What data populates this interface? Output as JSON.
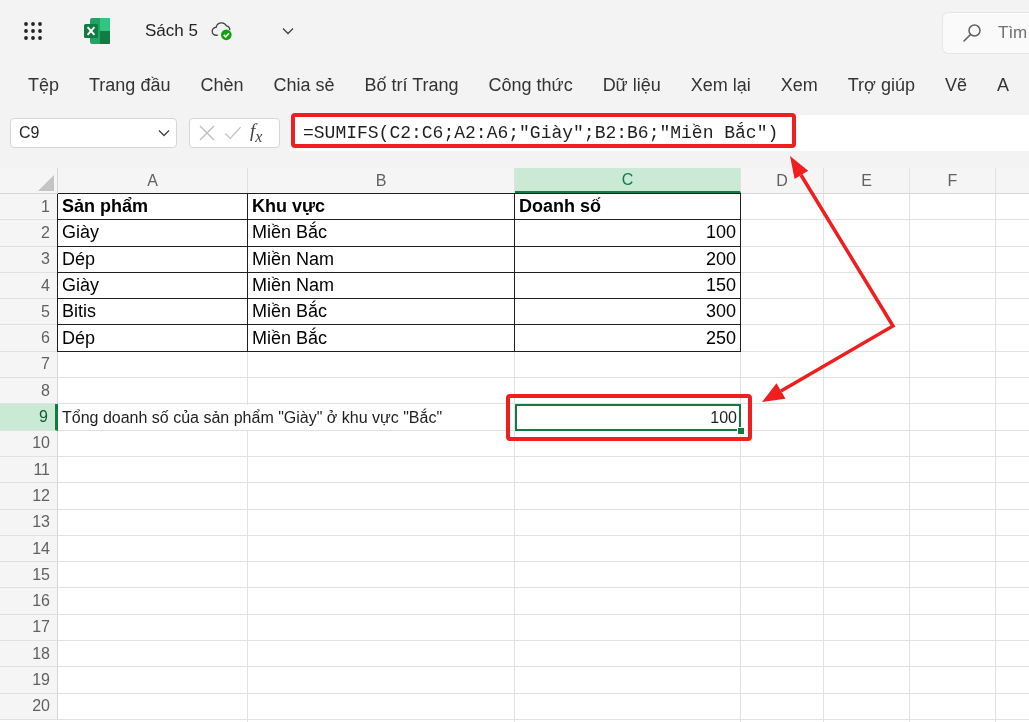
{
  "app_bar": {
    "document_title": "Sách 5",
    "search": {
      "placeholder": "Tìm"
    }
  },
  "menu": [
    "Tệp",
    "Trang đầu",
    "Chèn",
    "Chia sẻ",
    "Bố trí Trang",
    "Công thức",
    "Dữ liệu",
    "Xem lại",
    "Xem",
    "Trợ giúp",
    "Vẽ",
    "A"
  ],
  "formula_bar": {
    "name_box": "C9",
    "buttons_disabled": true,
    "function_button": "f$_{x}$",
    "formula": "=SUMIFS(C2:C6;A2:A6;\"Giày\";B2:B6;\"Miền Bắc\")"
  },
  "sheet": {
    "columns": [
      {
        "label": "A",
        "selected": false
      },
      {
        "label": "B",
        "selected": false
      },
      {
        "label": "C",
        "selected": true
      },
      {
        "label": "D",
        "selected": false
      },
      {
        "label": "E",
        "selected": false
      },
      {
        "label": "F",
        "selected": false
      }
    ],
    "rows": [
      {
        "number": "1",
        "selected": false,
        "bordered": true,
        "cells": [
          {
            "kind": "header",
            "text": "Sản phẩm"
          },
          {
            "kind": "header",
            "text": "Khu vực"
          },
          {
            "kind": "header",
            "text": "Doanh số"
          }
        ]
      },
      {
        "number": "2",
        "selected": false,
        "bordered": true,
        "cells": [
          {
            "kind": "text",
            "text": "Giày"
          },
          {
            "kind": "text",
            "text": "Miền Bắc"
          },
          {
            "kind": "number",
            "text": "100"
          }
        ]
      },
      {
        "number": "3",
        "selected": false,
        "bordered": true,
        "cells": [
          {
            "kind": "text",
            "text": "Dép"
          },
          {
            "kind": "text",
            "text": "Miền Nam"
          },
          {
            "kind": "number",
            "text": "200"
          }
        ]
      },
      {
        "number": "4",
        "selected": false,
        "bordered": true,
        "cells": [
          {
            "kind": "text",
            "text": "Giày"
          },
          {
            "kind": "text",
            "text": "Miền Nam"
          },
          {
            "kind": "number",
            "text": "150"
          }
        ]
      },
      {
        "number": "5",
        "selected": false,
        "bordered": true,
        "cells": [
          {
            "kind": "text",
            "text": "Bitis"
          },
          {
            "kind": "text",
            "text": "Miền Bắc"
          },
          {
            "kind": "number",
            "text": "300"
          }
        ]
      },
      {
        "number": "6",
        "selected": false,
        "bordered": true,
        "cells": [
          {
            "kind": "text",
            "text": "Dép"
          },
          {
            "kind": "text",
            "text": "Miền Bắc"
          },
          {
            "kind": "number",
            "text": "250"
          }
        ]
      },
      {
        "number": "7",
        "selected": false
      },
      {
        "number": "8",
        "selected": false
      },
      {
        "number": "9",
        "selected": true,
        "bordered": false,
        "cells": [
          {
            "kind": "text",
            "text": "Tổng doanh số của sản phẩm \"Giày\" ở khu vực \"Bắc\""
          },
          {
            "kind": "empty"
          },
          {
            "kind": "number",
            "text": "100"
          }
        ]
      },
      {
        "number": "10",
        "selected": false
      },
      {
        "number": "11",
        "selected": false
      },
      {
        "number": "12",
        "selected": false
      },
      {
        "number": "13",
        "selected": false
      },
      {
        "number": "14",
        "selected": false
      },
      {
        "number": "15",
        "selected": false
      },
      {
        "number": "16",
        "selected": false
      },
      {
        "number": "17",
        "selected": false
      },
      {
        "number": "18",
        "selected": false
      },
      {
        "number": "19",
        "selected": false
      },
      {
        "number": "20",
        "selected": false
      }
    ]
  },
  "annotations": [
    {
      "kind": "formula-frame"
    },
    {
      "kind": "cell-frame"
    },
    {
      "kind": "arrows"
    }
  ]
}
